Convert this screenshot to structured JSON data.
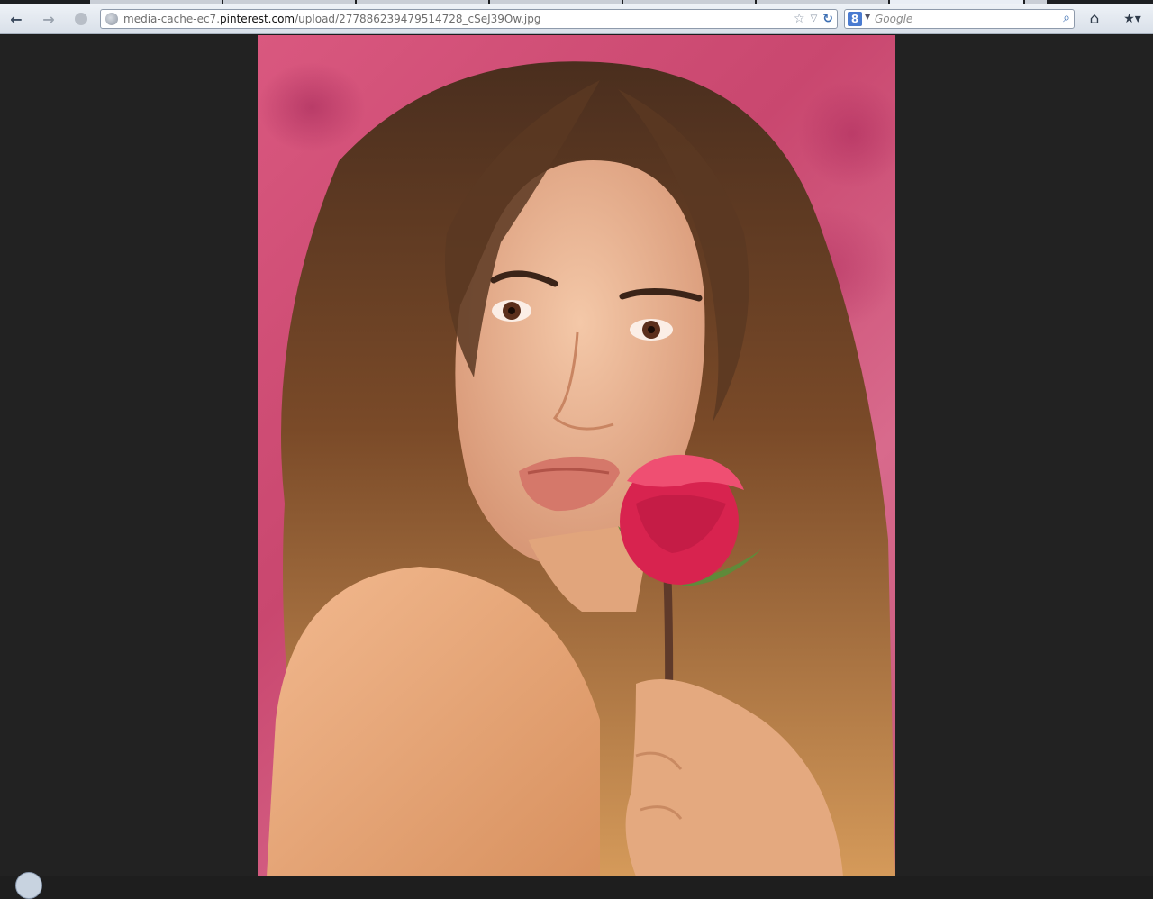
{
  "browser": {
    "url_prefix": "media-cache-ec7.",
    "url_domain": "pinterest.com",
    "url_path": "/upload/277886239479514728_cSeJ39Ow.jpg",
    "search": {
      "engine_icon": "8",
      "placeholder": "Google"
    }
  },
  "icons": {
    "back": "back-arrow-icon",
    "forward": "forward-arrow-icon",
    "identity": "site-identity-icon",
    "bookmark_star": "star-icon",
    "history_dropdown": "dropdown-arrow-icon",
    "reload": "reload-icon",
    "search": "magnifier-icon",
    "home": "home-icon",
    "bookmarks": "bookmarks-icon"
  },
  "colors": {
    "chrome_bg": "#dfe5ec",
    "viewer_bg": "#222222",
    "url_domain": "#111111",
    "url_rest": "#6d6d6d",
    "accent": "#3d6fb3"
  },
  "image": {
    "alt": "Portrait of woman holding a red rose"
  }
}
